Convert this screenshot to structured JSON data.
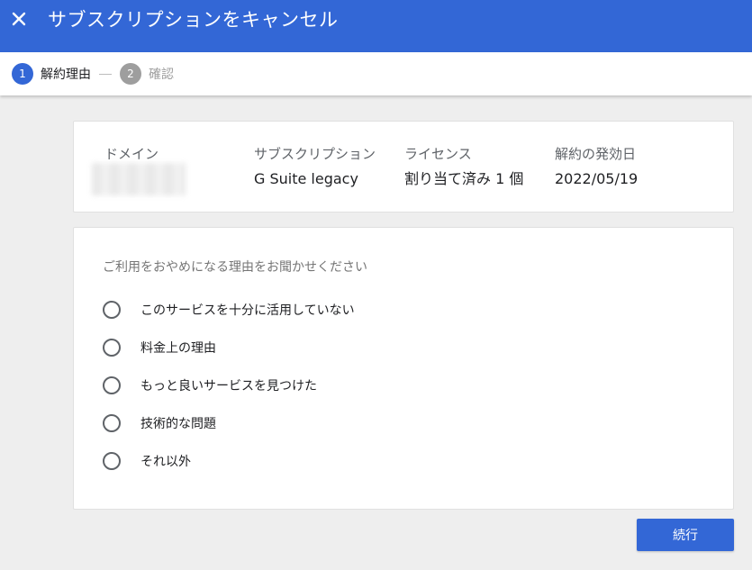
{
  "header": {
    "title": "サブスクリプションをキャンセル",
    "close_icon": "close-icon"
  },
  "stepper": {
    "steps": [
      {
        "number": "1",
        "label": "解約理由",
        "active": true
      },
      {
        "number": "2",
        "label": "確認",
        "active": false
      }
    ]
  },
  "info": {
    "domain_label": "ドメイン",
    "subscription_label": "サブスクリプション",
    "subscription_value": "G Suite legacy",
    "license_label": "ライセンス",
    "license_value": "割り当て済み 1 個",
    "date_label": "解約の発効日",
    "date_value": "2022/05/19"
  },
  "reasons": {
    "question": "ご利用をおやめになる理由をお聞かせください",
    "options": [
      "このサービスを十分に活用していない",
      "料金上の理由",
      "もっと良いサービスを見つけた",
      "技術的な問題",
      "それ以外"
    ]
  },
  "actions": {
    "continue_label": "続行"
  },
  "colors": {
    "accent": "#3367d6",
    "inactive_step": "#9e9e9e",
    "background": "#eeeeee"
  }
}
